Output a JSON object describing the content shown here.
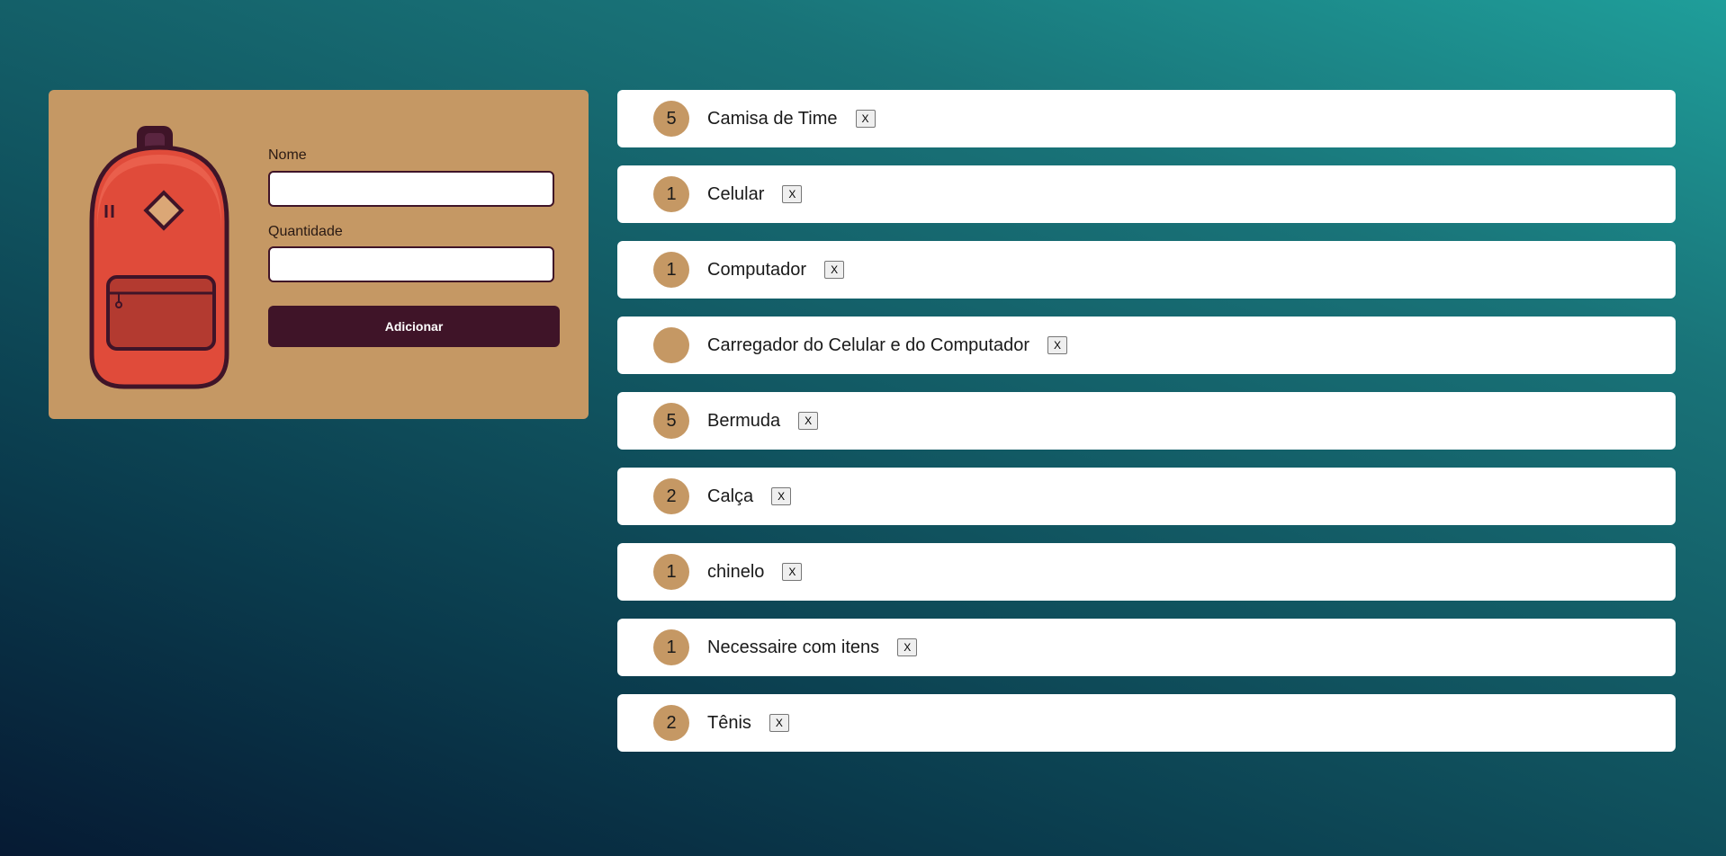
{
  "form": {
    "name_label": "Nome",
    "name_value": "",
    "quantity_label": "Quantidade",
    "quantity_value": "",
    "submit_label": "Adicionar"
  },
  "items": [
    {
      "quantity": "5",
      "name": "Camisa de Time",
      "remove_label": "X"
    },
    {
      "quantity": "1",
      "name": "Celular",
      "remove_label": "X"
    },
    {
      "quantity": "1",
      "name": "Computador",
      "remove_label": "X"
    },
    {
      "quantity": "",
      "name": "Carregador do Celular e do Computador",
      "remove_label": "X"
    },
    {
      "quantity": "5",
      "name": "Bermuda",
      "remove_label": "X"
    },
    {
      "quantity": "2",
      "name": "Calça",
      "remove_label": "X"
    },
    {
      "quantity": "1",
      "name": "chinelo",
      "remove_label": "X"
    },
    {
      "quantity": "1",
      "name": "Necessaire com itens",
      "remove_label": "X"
    },
    {
      "quantity": "2",
      "name": "Tênis",
      "remove_label": "X"
    }
  ],
  "colors": {
    "card": "#c59864",
    "accent": "#3f1428",
    "backpack": "#e04b3a",
    "row": "#ffffff"
  },
  "icons": {
    "illustration": "backpack-icon"
  }
}
